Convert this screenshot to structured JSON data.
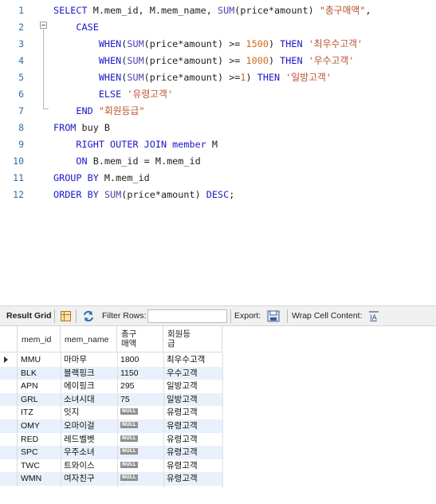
{
  "editor": {
    "lines": [
      {
        "n": "1",
        "html": "<span class=\"kw\">SELECT</span> M.mem_id, M.mem_name, <span class=\"fn\">SUM</span>(price*amount) <span class=\"str\">\"총구매액\"</span>,"
      },
      {
        "n": "2",
        "html": "    <span class=\"kw\">CASE</span>"
      },
      {
        "n": "3",
        "html": "        <span class=\"kw\">WHEN</span>(<span class=\"fn\">SUM</span>(price*amount) >= <span class=\"num\">1500</span>) <span class=\"kw\">THEN</span> <span class=\"str\">'최우수고객'</span>"
      },
      {
        "n": "4",
        "html": "        <span class=\"kw\">WHEN</span>(<span class=\"fn\">SUM</span>(price*amount) >= <span class=\"num\">1000</span>) <span class=\"kw\">THEN</span> <span class=\"str\">'우수고객'</span>"
      },
      {
        "n": "5",
        "html": "        <span class=\"kw\">WHEN</span>(<span class=\"fn\">SUM</span>(price*amount) >=<span class=\"num\">1</span>) <span class=\"kw\">THEN</span> <span class=\"str\">'일방고객'</span>"
      },
      {
        "n": "6",
        "html": "        <span class=\"kw\">ELSE</span> <span class=\"str\">'유령고객'</span>"
      },
      {
        "n": "7",
        "html": "    <span class=\"kw\">END</span> <span class=\"str\">\"회원등급\"</span>"
      },
      {
        "n": "8",
        "html": "<span class=\"kw\">FROM</span> buy B"
      },
      {
        "n": "9",
        "html": "    <span class=\"kw\">RIGHT OUTER JOIN</span> <span class=\"kw\">member</span> M"
      },
      {
        "n": "10",
        "html": "    <span class=\"kw\">ON</span> B.mem_id = M.mem_id"
      },
      {
        "n": "11",
        "html": "<span class=\"kw\">GROUP BY</span> M.mem_id"
      },
      {
        "n": "12",
        "html": "<span class=\"kw\">ORDER BY</span> <span class=\"fn\">SUM</span>(price*amount) <span class=\"kw\">DESC</span>;"
      }
    ]
  },
  "toolbar": {
    "result_grid": "Result Grid",
    "filter_rows": "Filter Rows:",
    "export": "Export:",
    "wrap_cell": "Wrap Cell Content:"
  },
  "grid": {
    "columns": [
      "mem_id",
      "mem_name",
      "총구\n매액",
      "회원등\n급"
    ],
    "rows": [
      [
        "MMU",
        "마마무",
        "1800",
        "최우수고객"
      ],
      [
        "BLK",
        "블랙핑크",
        "1150",
        "우수고객"
      ],
      [
        "APN",
        "에이핑크",
        "295",
        "일방고객"
      ],
      [
        "GRL",
        "소녀시대",
        "75",
        "일방고객"
      ],
      [
        "ITZ",
        "잇지",
        "NULL",
        "유령고객"
      ],
      [
        "OMY",
        "오마이걸",
        "NULL",
        "유령고객"
      ],
      [
        "RED",
        "레드벨벳",
        "NULL",
        "유령고객"
      ],
      [
        "SPC",
        "우주소녀",
        "NULL",
        "유령고객"
      ],
      [
        "TWC",
        "트와이스",
        "NULL",
        "유령고객"
      ],
      [
        "WMN",
        "여자친구",
        "NULL",
        "유령고객"
      ]
    ]
  }
}
